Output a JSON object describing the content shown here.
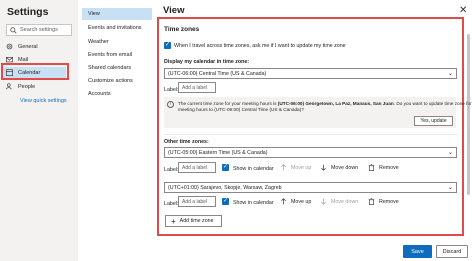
{
  "app": {
    "title": "Settings"
  },
  "search": {
    "placeholder": "Search settings"
  },
  "nav": {
    "items": [
      {
        "label": "General",
        "icon": "gear-icon"
      },
      {
        "label": "Mail",
        "icon": "mail-icon"
      },
      {
        "label": "Calendar",
        "icon": "calendar-icon"
      },
      {
        "label": "People",
        "icon": "people-icon"
      }
    ],
    "quick_link": "View quick settings"
  },
  "subnav": {
    "items": [
      "View",
      "Events and invitations",
      "Weather",
      "Events from email",
      "Shared calendars",
      "Customize actions",
      "Accounts"
    ]
  },
  "view": {
    "title": "View",
    "time_zones_heading": "Time zones",
    "travel_checkbox_label": "When I travel across time zones, ask me if I want to update my time zone",
    "display_label": "Display my calendar in time zone:",
    "primary_zone": "(UTC-06:00) Central Time (US & Canada)",
    "label_prefix": "Label:",
    "label_placeholder": "Add a label",
    "info_line1_a": "The current time zone for your meeting hours is ",
    "info_line1_b": "(UTC-06:00) Georgetown, La Paz, Manaus, San Juan",
    "info_line1_c": ". Do you want to update time zone for",
    "info_line2": "meeting hours to (UTC-06:00) Central Time (US & Canada)?",
    "update_button": "Yes, update",
    "other_heading": "Other time zones:",
    "other_zones": [
      {
        "zone": "(UTC-05:00) Eastern Time (US & Canada)"
      },
      {
        "zone": "(UTC+01:00) Sarajevo, Skopje, Warsaw, Zagreb"
      }
    ],
    "show_in_calendar": "Show in calendar",
    "move_up": "Move up",
    "move_down": "Move down",
    "remove": "Remove",
    "add_time_zone": "Add time zone"
  },
  "footer": {
    "save": "Save",
    "discard": "Discard"
  },
  "colors": {
    "accent": "#0f6cbd",
    "highlight": "#e04b4b",
    "selected_bg": "#c7e0f4"
  }
}
